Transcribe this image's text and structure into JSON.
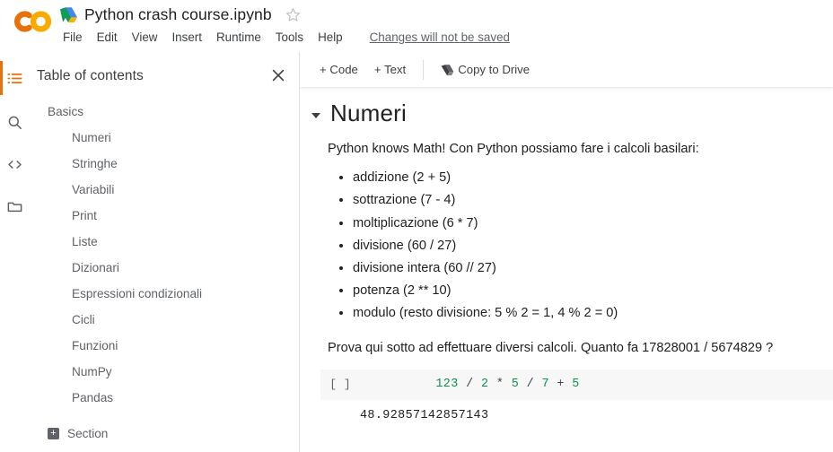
{
  "topbar": {
    "logo": "colab-logo",
    "drive_icon": "drive-icon",
    "doc_title": "Python crash course.ipynb",
    "star_icon": "star-outline-icon",
    "menus": [
      "File",
      "Edit",
      "View",
      "Insert",
      "Runtime",
      "Tools",
      "Help"
    ],
    "save_status": "Changes will not be saved"
  },
  "rail": {
    "items": [
      {
        "icon": "table-of-contents-icon",
        "active": true
      },
      {
        "icon": "search-icon",
        "active": false
      },
      {
        "icon": "code-snippets-icon",
        "active": false
      },
      {
        "icon": "files-folder-icon",
        "active": false
      }
    ]
  },
  "toc": {
    "title": "Table of contents",
    "close_icon": "close-icon",
    "groups": [
      {
        "label": "Basics",
        "level": 1
      },
      {
        "label": "Numeri",
        "level": 2
      },
      {
        "label": "Stringhe",
        "level": 2
      },
      {
        "label": "Variabili",
        "level": 2
      },
      {
        "label": "Print",
        "level": 2
      },
      {
        "label": "Liste",
        "level": 2
      },
      {
        "label": "Dizionari",
        "level": 2
      },
      {
        "label": "Espressioni condizionali",
        "level": 2
      },
      {
        "label": "Cicli",
        "level": 2
      },
      {
        "label": "Funzioni",
        "level": 2
      },
      {
        "label": "NumPy",
        "level": 2
      },
      {
        "label": "Pandas",
        "level": 2
      }
    ],
    "add_section": {
      "label": "Section",
      "icon": "plus-box-icon"
    }
  },
  "notebook": {
    "toolbar": {
      "add_code": "+ Code",
      "add_text": "+ Text",
      "copy_to_drive": "Copy to Drive",
      "copy_to_drive_icon": "drive-icon"
    },
    "heading": "Numeri",
    "intro": "Python knows Math! Con Python possiamo fare i calcoli basilari:",
    "bullets": [
      "addizione (2 + 5)",
      "sottrazione (7 - 4)",
      "moltiplicazione (6 * 7)",
      "divisione (60 / 27)",
      "divisione intera (60 // 27)",
      "potenza (2 ** 10)",
      "modulo (resto divisione: 5 % 2 = 1, 4 % 2 = 0)"
    ],
    "prompt_paragraph": "Prova qui sotto ad effettuare diversi calcoli. Quanto fa 17828001 / 5674829 ?",
    "cell": {
      "prompt": "[ ]",
      "tokens": [
        {
          "text": "123",
          "type": "num"
        },
        {
          "text": " / ",
          "type": "op"
        },
        {
          "text": "2",
          "type": "num"
        },
        {
          "text": " * ",
          "type": "op"
        },
        {
          "text": "5",
          "type": "num"
        },
        {
          "text": " / ",
          "type": "op"
        },
        {
          "text": "7",
          "type": "num"
        },
        {
          "text": " + ",
          "type": "op"
        },
        {
          "text": "5",
          "type": "num"
        }
      ],
      "code_text": "123 / 2 * 5 / 7 + 5",
      "output": "48.92857142857143"
    }
  },
  "colors": {
    "accent_orange": "#e8710a",
    "logo_yellow": "#f9ab00",
    "code_number": "#0d904f",
    "code_operator": "#37474f",
    "cell_bg": "#f7f7f7",
    "text_primary": "#202124",
    "text_secondary": "#5f6368"
  }
}
